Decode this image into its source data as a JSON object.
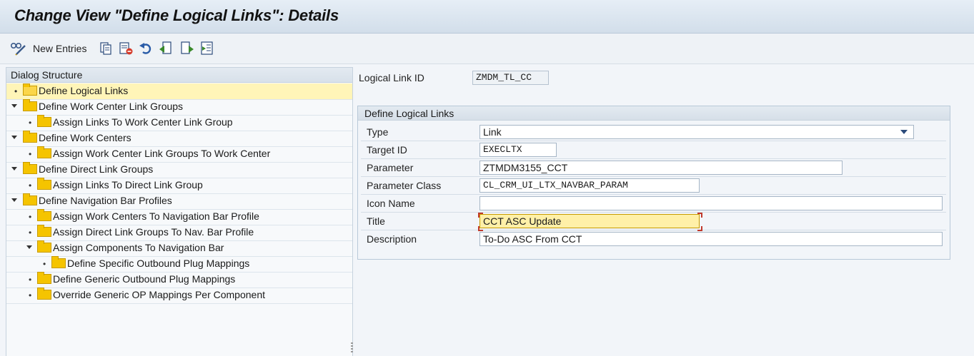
{
  "window": {
    "title": "Change View \"Define Logical Links\": Details"
  },
  "toolbar": {
    "new_entries_label": "New Entries"
  },
  "dialog_structure": {
    "title": "Dialog Structure",
    "items": [
      {
        "label": "Define Logical Links",
        "level": 0,
        "expanded": false,
        "selected": true
      },
      {
        "label": "Define Work Center Link Groups",
        "level": 0,
        "expanded": true
      },
      {
        "label": "Assign Links To Work Center Link Group",
        "level": 1
      },
      {
        "label": "Define Work Centers",
        "level": 0,
        "expanded": true
      },
      {
        "label": "Assign Work Center Link Groups To Work Center",
        "level": 1
      },
      {
        "label": "Define Direct Link Groups",
        "level": 0,
        "expanded": true
      },
      {
        "label": "Assign Links To Direct Link Group",
        "level": 1
      },
      {
        "label": "Define Navigation Bar Profiles",
        "level": 0,
        "expanded": true
      },
      {
        "label": "Assign Work Centers To Navigation Bar Profile",
        "level": 1
      },
      {
        "label": "Assign Direct Link Groups To Nav. Bar Profile",
        "level": 1
      },
      {
        "label": "Assign Components To Navigation Bar",
        "level": 1,
        "expanded": true
      },
      {
        "label": "Define Specific Outbound Plug Mappings",
        "level": 2
      },
      {
        "label": "Define Generic Outbound Plug Mappings",
        "level": 1
      },
      {
        "label": "Override Generic OP Mappings Per Component",
        "level": 1
      }
    ]
  },
  "key": {
    "label": "Logical Link ID",
    "value": "ZMDM_TL_CC"
  },
  "details": {
    "title": "Define Logical Links",
    "type": {
      "label": "Type",
      "value": "Link"
    },
    "target_id": {
      "label": "Target ID",
      "value": "EXECLTX"
    },
    "parameter": {
      "label": "Parameter",
      "value": "ZTMDM3155_CCT"
    },
    "parameter_class": {
      "label": "Parameter Class",
      "value": "CL_CRM_UI_LTX_NAVBAR_PARAM"
    },
    "icon_name": {
      "label": "Icon Name",
      "value": ""
    },
    "title_field": {
      "label": "Title",
      "value": "CCT ASC Update"
    },
    "description": {
      "label": "Description",
      "value": "To-Do ASC From CCT"
    }
  },
  "colors": {
    "selected_row": "#fff5b8",
    "focus_field": "#fff0a8",
    "folder": "#f5c400"
  }
}
